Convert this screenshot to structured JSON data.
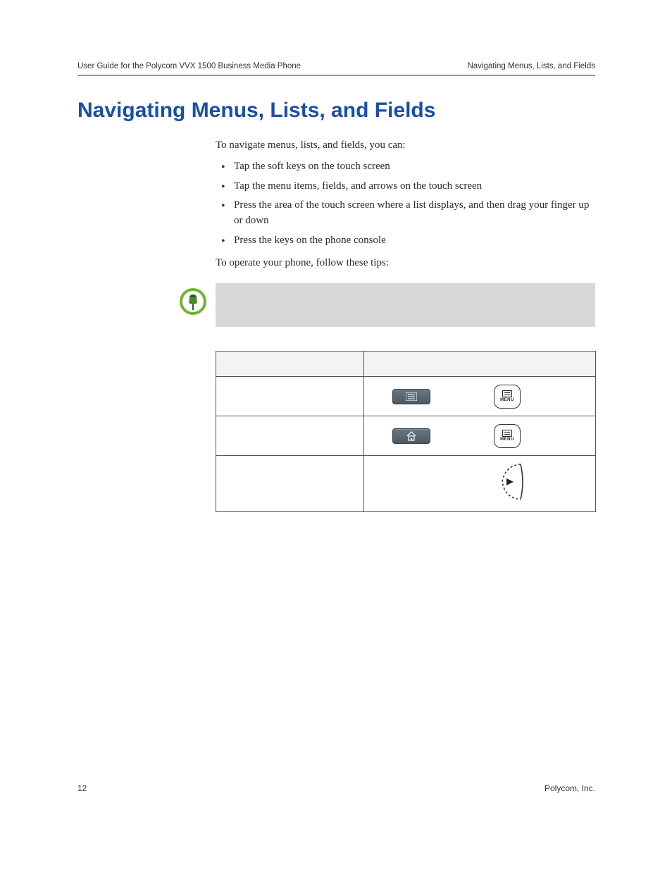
{
  "header": {
    "left": "User Guide for the Polycom VVX 1500 Business Media Phone",
    "right": "Navigating Menus, Lists, and Fields"
  },
  "title": "Navigating Menus, Lists, and Fields",
  "intro": "To navigate menus, lists, and fields, you can:",
  "bullets": [
    "Tap the soft keys on the touch screen",
    "Tap the menu items, fields, and arrows on the touch screen",
    "Press the area of the touch screen where a list displays, and then drag your finger up or down",
    "Press the keys on the phone console"
  ],
  "tips_intro": "To operate your phone, follow these tips:",
  "menu_key_label": "MENU",
  "footer": {
    "page": "12",
    "company": "Polycom, Inc."
  }
}
